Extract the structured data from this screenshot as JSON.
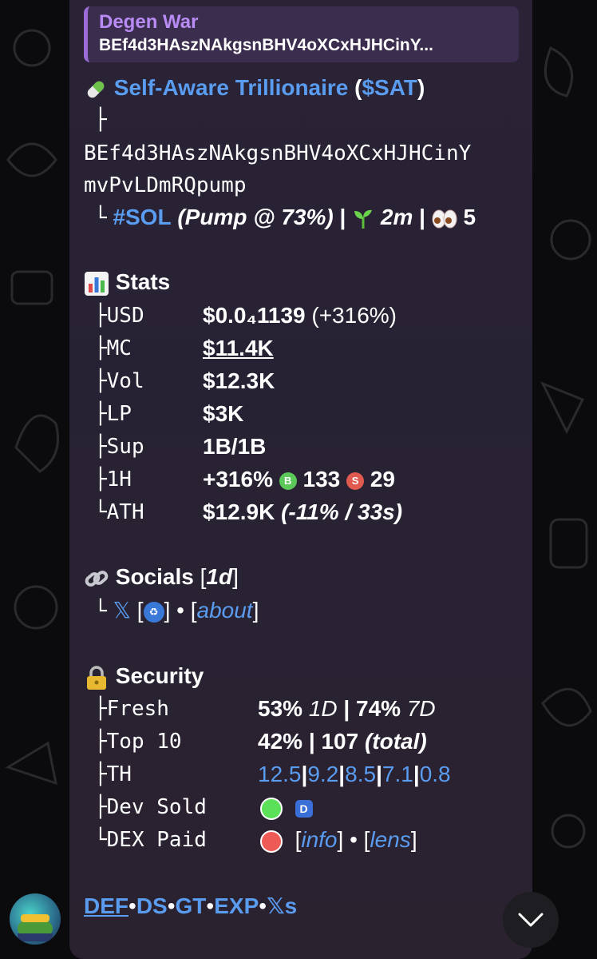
{
  "reply": {
    "title": "Degen War",
    "text": "BEf4d3HAszNAkgsnBHV4oXCxHJHCinY..."
  },
  "token": {
    "name": "Self-Aware Trillionaire",
    "ticker": "$SAT",
    "tree_mid": "├",
    "address_line1": "BEf4d3HAszNAkgsnBHV4oXCxHJHCinY",
    "address_line2": "mvPvLDmRQpump",
    "tree_end": "└",
    "chain": "#SOL",
    "pump": "(Pump @ 73%)",
    "age": "2m",
    "watchers": "5"
  },
  "stats": {
    "heading": "Stats",
    "rows": [
      {
        "tree": "├",
        "label": "USD",
        "value": "$0.0₄1139",
        "extra": "(+316%)"
      },
      {
        "tree": "├",
        "label": "MC",
        "value": "$11.4K"
      },
      {
        "tree": "├",
        "label": "Vol",
        "value": "$12.3K"
      },
      {
        "tree": "├",
        "label": "LP",
        "value": "$3K"
      },
      {
        "tree": "├",
        "label": "Sup",
        "value": "1B/1B"
      },
      {
        "tree": "├",
        "label": "1H",
        "value": "+316%",
        "buys_badge": "B",
        "buys": "133",
        "sells_badge": "S",
        "sells": "29"
      },
      {
        "tree": "└",
        "label": "ATH",
        "value": "$12.9K",
        "extra": "(-11% / 33s)"
      }
    ]
  },
  "socials": {
    "heading": "Socials",
    "age": "1d",
    "x_icon": "𝕏",
    "about": "about"
  },
  "security": {
    "heading": "Security",
    "fresh_label": "Fresh",
    "fresh_1d": "53%",
    "fresh_1d_tag": "1D",
    "fresh_7d": "74%",
    "fresh_7d_tag": "7D",
    "top10_label": "Top 10",
    "top10_pct": "42%",
    "top10_total": "107",
    "top10_total_tag": "(total)",
    "th_label": "TH",
    "th_values": [
      "12.5",
      "9.2",
      "8.5",
      "7.1",
      "0.8"
    ],
    "dev_label": "Dev Sold",
    "dev_badge": "D",
    "dex_label": "DEX Paid",
    "info": "info",
    "lens": "lens"
  },
  "footer": {
    "links": [
      "DEF",
      "DS",
      "GT",
      "EXP",
      "𝕏s"
    ],
    "separator": "•"
  },
  "colors": {
    "link": "#5a9cf0",
    "reply_accent": "#9b6bd6",
    "green": "#5ce05a",
    "red": "#ee5a55"
  }
}
